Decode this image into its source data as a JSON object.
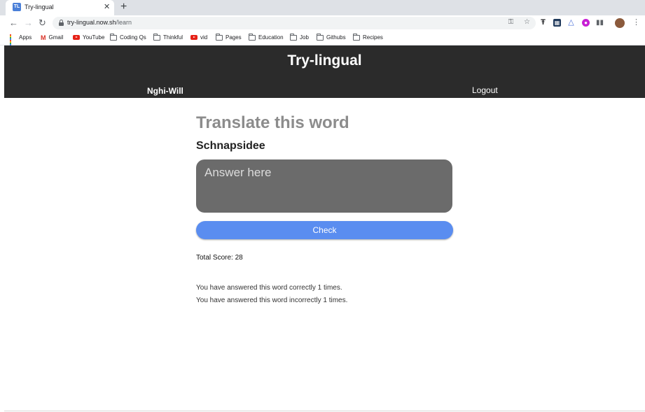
{
  "browser": {
    "tab_favicon": "TL",
    "tab_title": "Try-lingual",
    "tab_close": "✕",
    "new_tab": "+",
    "url_host": "try-lingual.now.sh",
    "url_path": "/learn",
    "icons": [
      "key-icon",
      "star-icon",
      "extension-icon",
      "kebab-menu-icon"
    ]
  },
  "bookmarks": [
    {
      "label": "Apps",
      "icon": "apps-grid-icon"
    },
    {
      "label": "Gmail",
      "icon": "gmail-icon"
    },
    {
      "label": "YouTube",
      "icon": "youtube-icon"
    },
    {
      "label": "Coding Qs",
      "icon": "folder-icon"
    },
    {
      "label": "Thinkful",
      "icon": "folder-icon"
    },
    {
      "label": "vid",
      "icon": "youtube-icon"
    },
    {
      "label": "Pages",
      "icon": "folder-icon"
    },
    {
      "label": "Education",
      "icon": "folder-icon"
    },
    {
      "label": "Job",
      "icon": "folder-icon"
    },
    {
      "label": "Githubs",
      "icon": "folder-icon"
    },
    {
      "label": "Recipes",
      "icon": "folder-icon"
    }
  ],
  "header": {
    "title": "Try-lingual",
    "user": "Nghi-Will",
    "logout": "Logout"
  },
  "learn": {
    "heading": "Translate this word",
    "word": "Schnapsidee",
    "answer_placeholder": "Answer here",
    "check_label": "Check",
    "total_score": "Total Score: 28",
    "correct_text": "You have answered this word correctly 1 times.",
    "incorrect_text": "You have answered this word incorrectly 1 times."
  },
  "colors": {
    "header_bg": "#2b2b2b",
    "answer_bg": "#6b6b6b",
    "check_bg": "#5a8df0",
    "heading": "#8c8c8c"
  }
}
